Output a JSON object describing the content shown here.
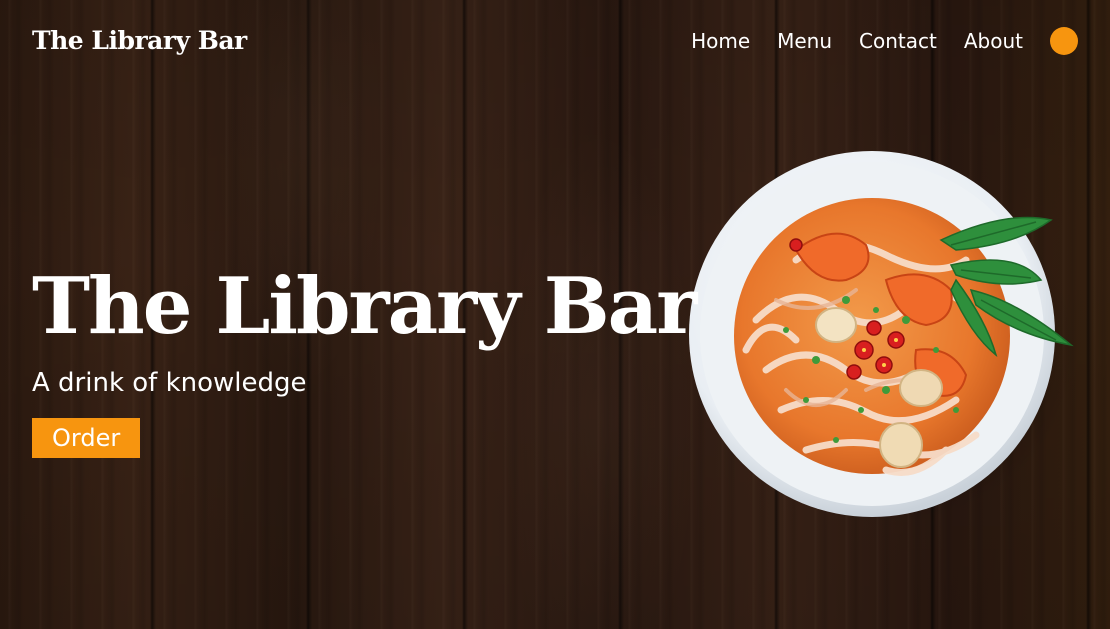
{
  "brand": {
    "name": "The Library Bar"
  },
  "nav": {
    "items": [
      {
        "label": "Home"
      },
      {
        "label": "Menu"
      },
      {
        "label": "Contact"
      },
      {
        "label": "About"
      }
    ],
    "toggle_icon": "theme-toggle-dot"
  },
  "hero": {
    "title": "The Library Bar",
    "tagline": "A drink of knowledge",
    "order_label": "Order",
    "image": "noodle-soup-bowl"
  },
  "colors": {
    "accent": "#f7950f",
    "text": "#ffffff",
    "background_wood": "#2c1a10"
  }
}
